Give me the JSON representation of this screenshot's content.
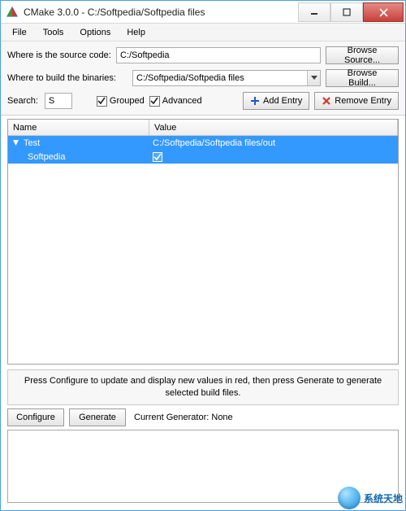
{
  "window": {
    "title": "CMake 3.0.0 - C:/Softpedia/Softpedia files"
  },
  "menu": {
    "file": "File",
    "tools": "Tools",
    "options": "Options",
    "help": "Help"
  },
  "panel": {
    "source_label": "Where is the source code:",
    "source_value": "C:/Softpedia",
    "browse_source": "Browse Source...",
    "build_label": "Where to build the binaries:",
    "build_value": "C:/Softpedia/Softpedia files",
    "browse_build": "Browse Build...",
    "search_label": "Search:",
    "search_value": "S",
    "grouped_label": "Grouped",
    "advanced_label": "Advanced",
    "add_entry": "Add Entry",
    "remove_entry": "Remove Entry"
  },
  "table": {
    "header_name": "Name",
    "header_value": "Value",
    "rows": {
      "r0_name": "Test",
      "r0_value": "C:/Softpedia/Softpedia files/out",
      "r1_name": "Softpedia"
    }
  },
  "bottom": {
    "helper": "Press Configure to update and display new values in red, then press Generate to generate selected build files.",
    "configure": "Configure",
    "generate": "Generate",
    "generator_label": "Current Generator: None"
  },
  "watermark": "系统天地"
}
